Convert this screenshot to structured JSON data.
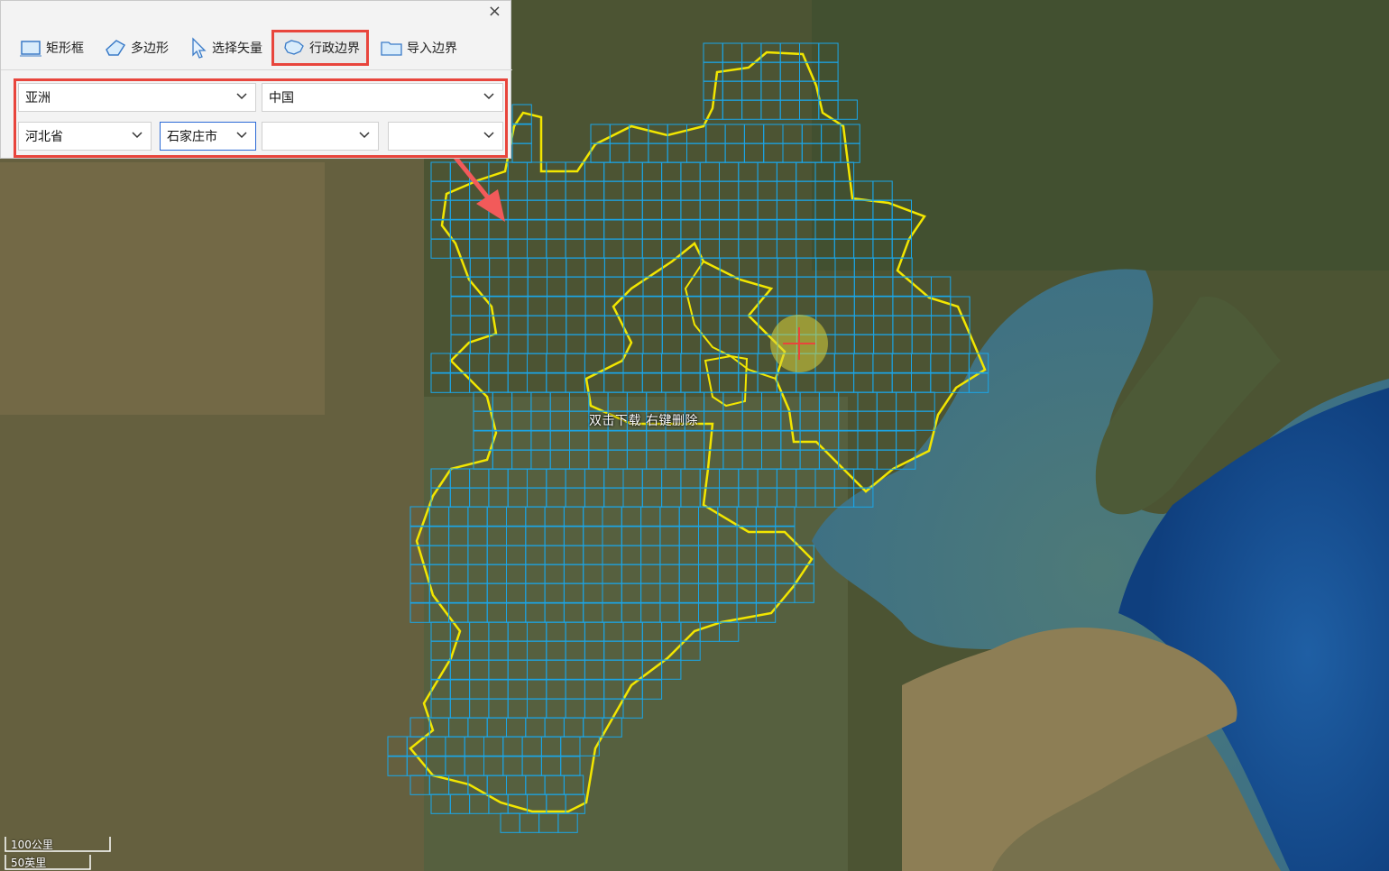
{
  "window": {
    "close_symbol": "×"
  },
  "toolbar": {
    "items": [
      {
        "label": "矩形框",
        "icon": "rectangle-icon"
      },
      {
        "label": "多边形",
        "icon": "polygon-icon"
      },
      {
        "label": "选择矢量",
        "icon": "cursor-icon"
      },
      {
        "label": "行政边界",
        "icon": "region-map-icon"
      },
      {
        "label": "导入边界",
        "icon": "folder-icon"
      }
    ],
    "active_index": 3
  },
  "selectors": {
    "continent": "亚洲",
    "country": "中国",
    "province": "河北省",
    "city": "石家庄市",
    "county": "",
    "town": ""
  },
  "map": {
    "hint": "双击下载 右键删除",
    "scale_km": "100公里",
    "scale_mi": "50英里"
  },
  "colors": {
    "accent_red": "#e8453c",
    "grid_blue": "#1aa6e8",
    "boundary_yellow": "#f2e600"
  }
}
